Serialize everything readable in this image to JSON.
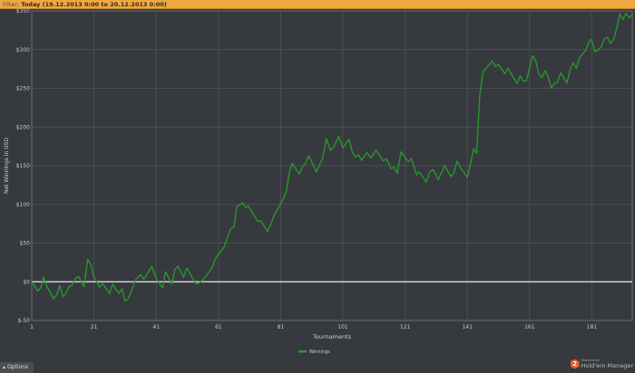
{
  "filter": {
    "label": "Filter:",
    "value": "Today (19.12.2013 0:00 to 20.12.2013 0:00)"
  },
  "options_label": "Options",
  "brand": {
    "powered": "Powered by",
    "name": "Hold'em Manager",
    "logo_digit": "2"
  },
  "colors": {
    "series": "#2a9a2a",
    "zero_line": "#e8e8e8",
    "grid": "#4b4f53",
    "header": "#f0a840"
  },
  "chart_data": {
    "type": "line",
    "title": "",
    "xlabel": "Tournaments",
    "ylabel": "Net Winnings in USD",
    "xlim": [
      1,
      194
    ],
    "ylim": [
      -50,
      350
    ],
    "x_ticks": [
      1,
      21,
      41,
      61,
      81,
      101,
      121,
      141,
      161,
      181
    ],
    "y_ticks": [
      -50,
      0,
      50,
      100,
      150,
      200,
      250,
      300,
      350
    ],
    "y_tick_labels": [
      "$-50",
      "$0",
      "$50",
      "$100",
      "$150",
      "$200",
      "$250",
      "$300",
      "$350"
    ],
    "grid": true,
    "legend": {
      "position": "bottom-center",
      "entries": [
        "Winnings"
      ]
    },
    "series": [
      {
        "name": "Winnings",
        "x": [
          1,
          3,
          4,
          4.8,
          6,
          8,
          9,
          10,
          11,
          12,
          13,
          14,
          15,
          16,
          17.8,
          19,
          20,
          21,
          22.8,
          23.7,
          26,
          27,
          29,
          30,
          31,
          32,
          33,
          34.4,
          36,
          37,
          39.6,
          41,
          43,
          44,
          46,
          47,
          48,
          49.8,
          50.8,
          53.8,
          55,
          56.5,
          58.8,
          60,
          62.8,
          65,
          66,
          66.9,
          68.8,
          69.7,
          70.6,
          73.6,
          74.6,
          76.8,
          79,
          81.4,
          82.8,
          83.7,
          84.7,
          87,
          88,
          89,
          90,
          92.5,
          94.5,
          95.7,
          97,
          98,
          99.7,
          101,
          103,
          104,
          105,
          106,
          107,
          108.7,
          110,
          111.6,
          114,
          115,
          116.5,
          117.5,
          118.5,
          119.7,
          122,
          123,
          124.7,
          125.5,
          127.8,
          129,
          130,
          131.7,
          133.7,
          135.7,
          136.7,
          137.7,
          139,
          141,
          141.6,
          143,
          144,
          145,
          146,
          149,
          150,
          151,
          153,
          154,
          157,
          158,
          159,
          160,
          162,
          163,
          164,
          165,
          166,
          167,
          168,
          169,
          170,
          171,
          173,
          174,
          175,
          176,
          177,
          179,
          180.5,
          181,
          182,
          184,
          185,
          186,
          187,
          188,
          189,
          190,
          191,
          192,
          193,
          194
        ],
        "y": [
          0,
          -12,
          -7,
          6,
          -7,
          -22,
          -17,
          -5,
          -19,
          -15,
          -6,
          -4,
          4,
          7,
          -6,
          29,
          22,
          6,
          -7,
          -2,
          -15,
          -3,
          -15,
          -9,
          -25,
          -22,
          -12,
          3,
          9,
          3,
          20,
          4,
          -8,
          13,
          -3,
          16,
          20,
          6,
          18,
          -3,
          -1,
          5,
          17,
          30,
          45,
          69,
          71,
          97,
          102,
          96,
          98,
          78,
          79,
          65,
          86,
          104,
          116,
          140,
          153,
          139,
          149,
          153,
          163,
          142,
          160,
          185,
          170,
          174,
          188,
          173,
          184,
          168,
          161,
          164,
          157,
          167,
          160,
          170,
          156,
          159,
          146,
          148,
          140,
          168,
          155,
          159,
          138,
          142,
          129,
          142,
          145,
          132,
          150,
          136,
          141,
          156,
          146,
          135,
          145,
          172,
          166,
          242,
          271,
          285,
          278,
          281,
          269,
          276,
          256,
          266,
          259,
          260,
          292,
          285,
          268,
          264,
          273,
          264,
          250,
          256,
          258,
          270,
          257,
          274,
          283,
          276,
          289,
          299,
          313,
          312,
          297,
          303,
          314,
          316,
          308,
          313,
          327,
          346,
          339,
          347,
          341,
          345
        ]
      }
    ]
  }
}
